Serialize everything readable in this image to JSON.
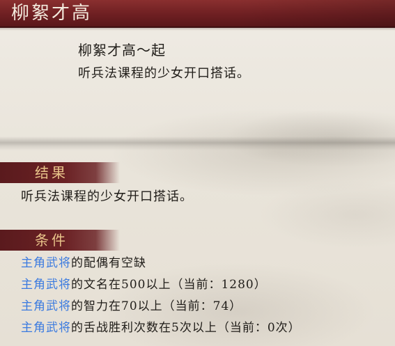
{
  "window": {
    "title": "柳絮才高"
  },
  "event": {
    "title": "柳絮才高～起",
    "description": "听兵法课程的少女开口搭话。"
  },
  "result": {
    "header": "结果",
    "text": "听兵法课程的少女开口搭话。"
  },
  "conditions": {
    "header": "条件",
    "items": [
      {
        "subject": "主角武将",
        "text": "的配偶有空缺"
      },
      {
        "subject": "主角武将",
        "text": "的文名在500以上（当前：1280）"
      },
      {
        "subject": "主角武将",
        "text": "的智力在70以上（当前：74）"
      },
      {
        "subject": "主角武将",
        "text": "的舌战胜利次数在5次以上（当前：0次）"
      }
    ]
  },
  "colors": {
    "title_bar": "#6e1f22",
    "section_header": "#6b2225",
    "section_label": "#e9c48a",
    "link": "#3a7ae0",
    "body_text": "#1f1c18"
  }
}
